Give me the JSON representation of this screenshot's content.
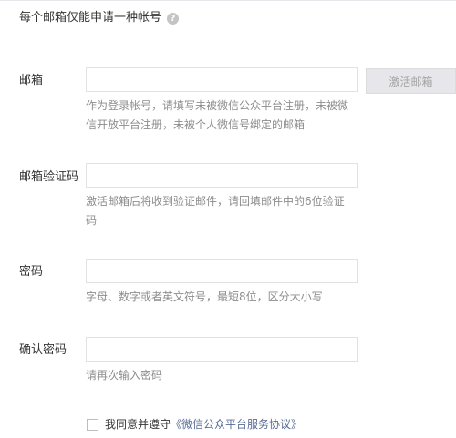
{
  "notice": {
    "text": "每个邮箱仅能申请一种帐号",
    "help_icon": "?"
  },
  "email": {
    "label": "邮箱",
    "value": "",
    "hint": "作为登录帐号，请填写未被微信公众平台注册，未被微信开放平台注册，未被个人微信号绑定的邮箱",
    "activate_button": "激活邮箱"
  },
  "code": {
    "label": "邮箱验证码",
    "value": "",
    "hint": "激活邮箱后将收到验证邮件，请回填邮件中的6位验证码"
  },
  "password": {
    "label": "密码",
    "value": "",
    "hint": "字母、数字或者英文符号，最短8位，区分大小写"
  },
  "confirm": {
    "label": "确认密码",
    "value": "",
    "hint": "请再次输入密码"
  },
  "agreement": {
    "checked": false,
    "text": "我同意并遵守",
    "link": "《微信公众平台服务协议》"
  },
  "colors": {
    "link": "#576b95",
    "hint": "#8d8d8d",
    "disabled_button_bg": "#e7e7eb"
  }
}
